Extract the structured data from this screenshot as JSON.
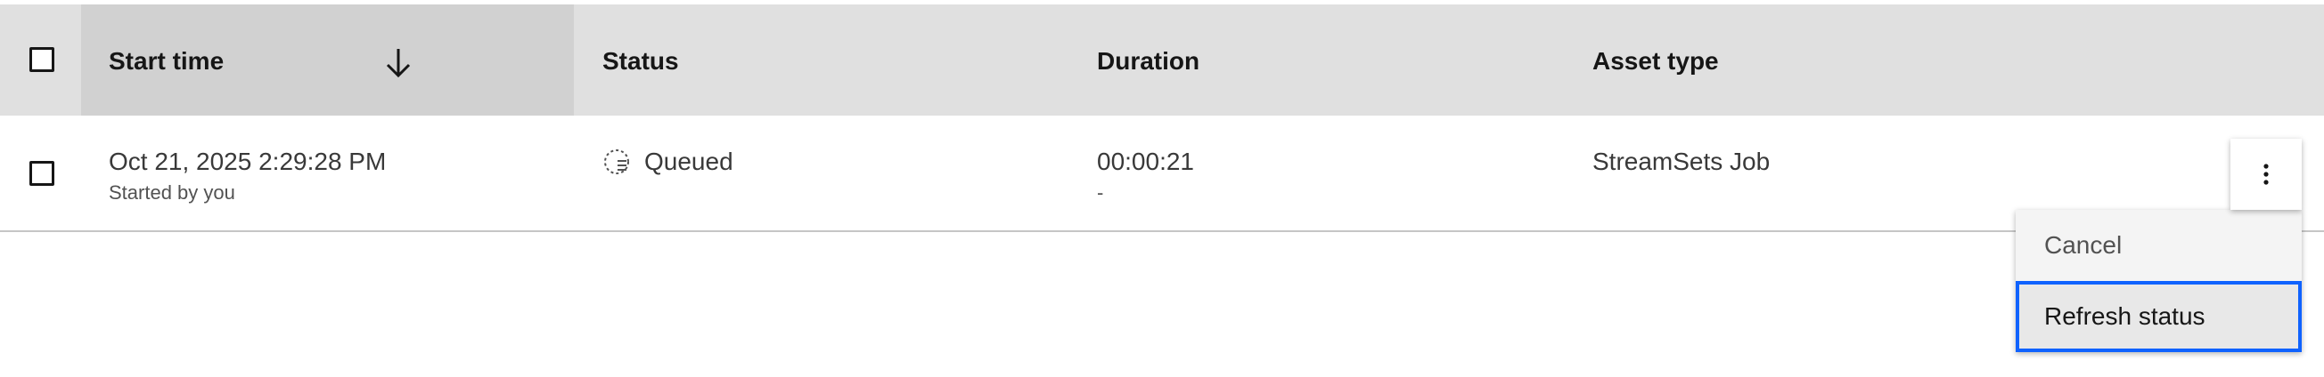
{
  "table": {
    "headers": {
      "start_time": "Start time",
      "status": "Status",
      "duration": "Duration",
      "asset_type": "Asset type"
    },
    "sort": {
      "column": "start_time",
      "direction": "descending",
      "icon": "arrow-down-icon"
    },
    "rows": [
      {
        "start_time": "Oct 21, 2025 2:29:28 PM",
        "started_by": "Started by you",
        "status_icon": "queued-icon",
        "status": "Queued",
        "duration": "00:00:21",
        "duration_sub": "-",
        "asset_type": "StreamSets Job"
      }
    ]
  },
  "overflow_menu": {
    "icon": "overflow-menu-vertical-icon",
    "items": [
      {
        "label": "Cancel"
      },
      {
        "label": "Refresh status"
      }
    ]
  },
  "colors": {
    "header_bg": "#e0e0e0",
    "sorted_header_bg": "#d1d1d1",
    "focus_border": "#0f62fe"
  }
}
